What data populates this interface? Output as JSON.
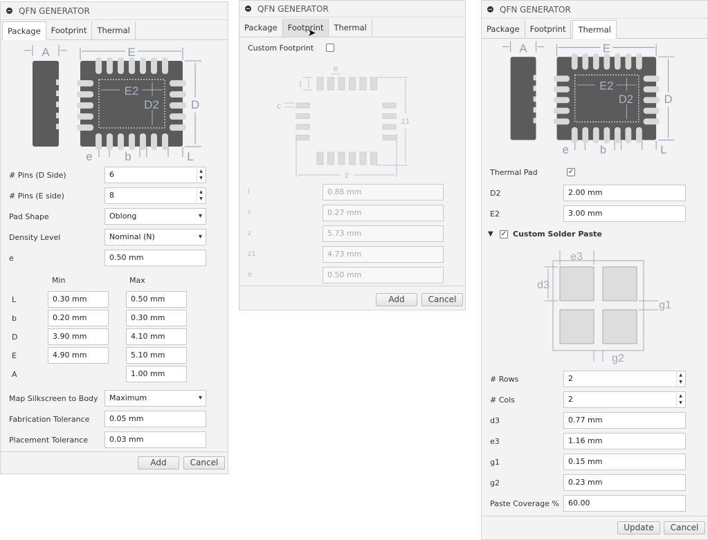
{
  "title": "QFN GENERATOR",
  "tabs": [
    "Package",
    "Footprint",
    "Thermal"
  ],
  "package_diagram": {
    "A": "A",
    "E": "E",
    "E2": "E2",
    "D2": "D2",
    "D": "D",
    "e": "e",
    "b": "b",
    "L": "L"
  },
  "package": {
    "pins_d": {
      "label": "# Pins (D Side)",
      "value": "6"
    },
    "pins_e": {
      "label": "# Pins (E side)",
      "value": "8"
    },
    "pad_shape": {
      "label": "Pad Shape",
      "value": "Oblong"
    },
    "density": {
      "label": "Density Level",
      "value": "Nominal (N)"
    },
    "e": {
      "label": "e",
      "value": "0.50 mm"
    },
    "min_header": "Min",
    "max_header": "Max",
    "dims": [
      {
        "label": "L",
        "min": "0.30 mm",
        "max": "0.50 mm"
      },
      {
        "label": "b",
        "min": "0.20 mm",
        "max": "0.30 mm"
      },
      {
        "label": "D",
        "min": "3.90 mm",
        "max": "4.10 mm"
      },
      {
        "label": "E",
        "min": "4.90 mm",
        "max": "5.10 mm"
      },
      {
        "label": "A",
        "min": null,
        "max": "1.00 mm"
      }
    ],
    "silkscreen": {
      "label": "Map Silkscreen to Body",
      "value": "Maximum"
    },
    "fab_tol": {
      "label": "Fabrication Tolerance",
      "value": "0.05 mm"
    },
    "place_tol": {
      "label": "Placement Tolerance",
      "value": "0.03 mm"
    },
    "add": "Add",
    "cancel": "Cancel"
  },
  "footprint": {
    "custom_label": "Custom Footprint",
    "custom_checked": false,
    "diagram": {
      "e": "e",
      "l": "l",
      "c": "c",
      "z1": "z1",
      "z": "z"
    },
    "fields": [
      {
        "label": "l",
        "value": "0.86 mm"
      },
      {
        "label": "c",
        "value": "0.27 mm"
      },
      {
        "label": "z",
        "value": "5.73 mm"
      },
      {
        "label": "z1",
        "value": "4.73 mm"
      },
      {
        "label": "e",
        "value": "0.50 mm"
      }
    ],
    "add": "Add",
    "cancel": "Cancel"
  },
  "thermal": {
    "thermal_pad": {
      "label": "Thermal Pad",
      "checked": true
    },
    "d2": {
      "label": "D2",
      "value": "2.00 mm"
    },
    "e2": {
      "label": "E2",
      "value": "3.00 mm"
    },
    "custom_paste": {
      "label": "Custom Solder Paste",
      "checked": true
    },
    "paste_diagram": {
      "e3": "e3",
      "d3": "d3",
      "g1": "g1",
      "g2": "g2"
    },
    "rows": {
      "label": "# Rows",
      "value": "2"
    },
    "cols": {
      "label": "# Cols",
      "value": "2"
    },
    "d3": {
      "label": "d3",
      "value": "0.77 mm"
    },
    "e3": {
      "label": "e3",
      "value": "1.16 mm"
    },
    "g1": {
      "label": "g1",
      "value": "0.15 mm"
    },
    "g2": {
      "label": "g2",
      "value": "0.23 mm"
    },
    "coverage": {
      "label": "Paste Coverage %",
      "value": "60.00"
    },
    "update": "Update",
    "cancel": "Cancel"
  }
}
